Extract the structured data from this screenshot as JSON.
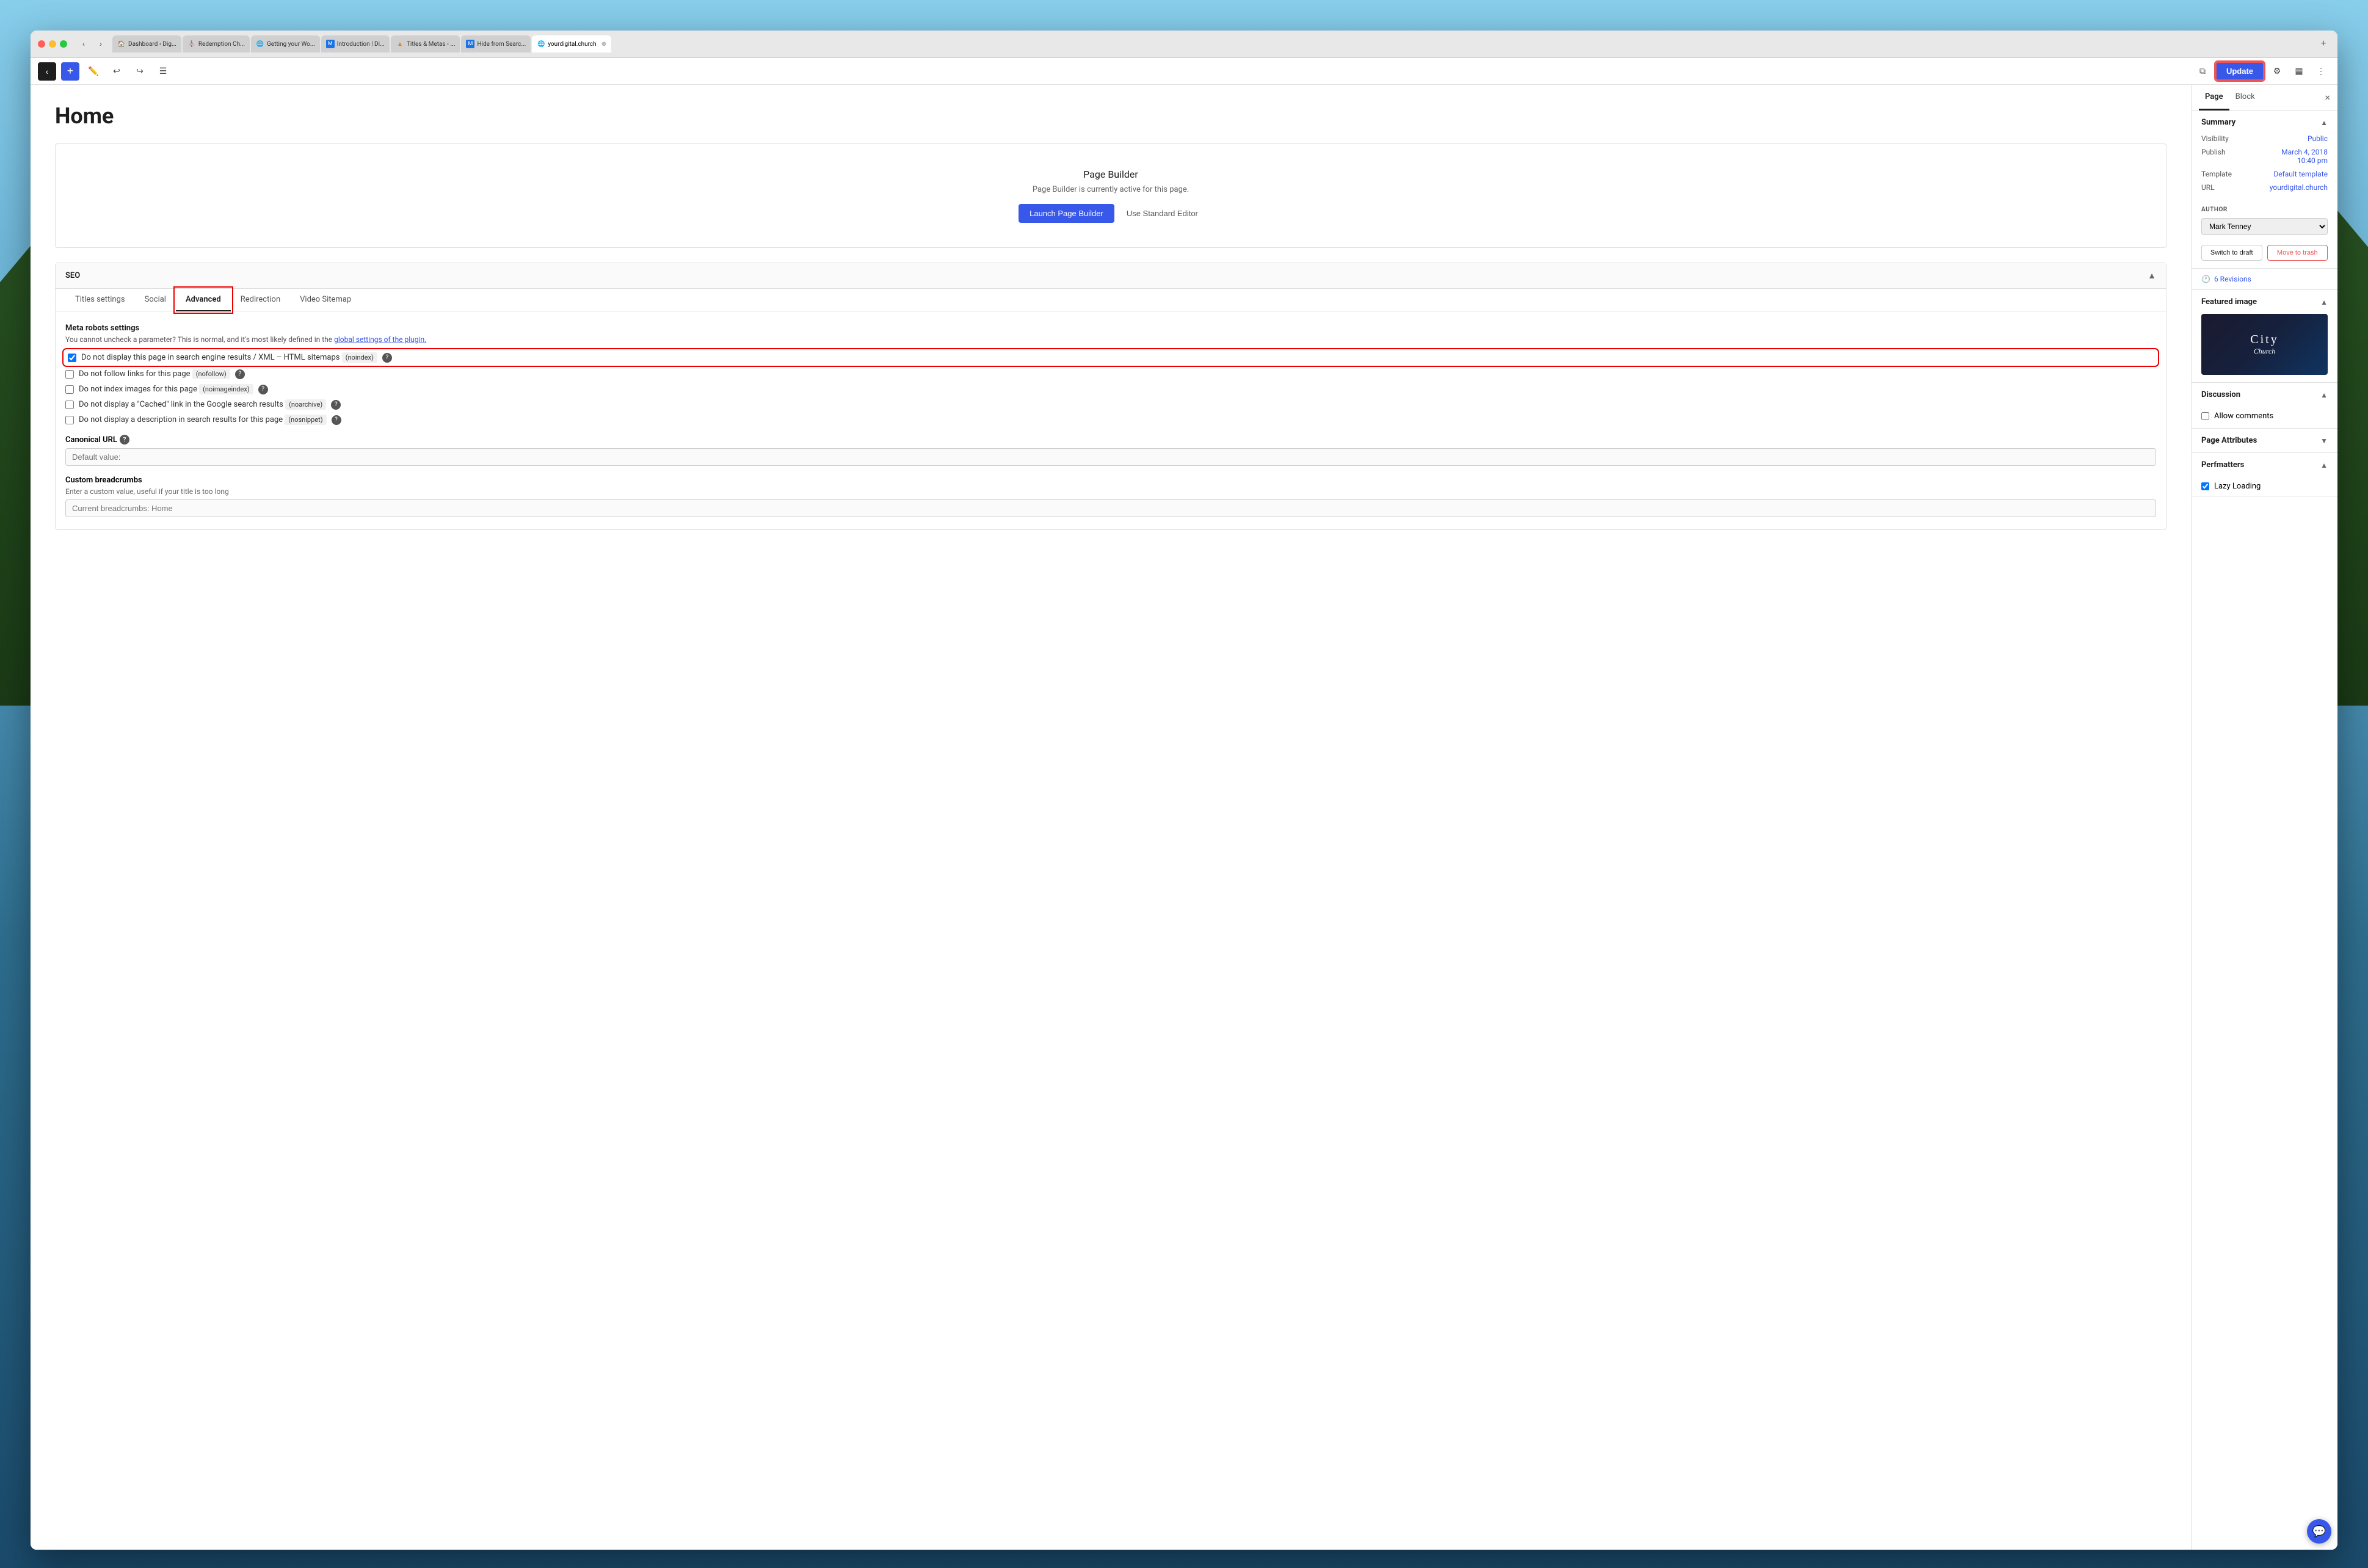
{
  "browser": {
    "tabs": [
      {
        "label": "Dashboard ‹ Dig...",
        "favicon": "🏠",
        "active": false
      },
      {
        "label": "Redemption Ch...",
        "favicon": "⛪",
        "active": false
      },
      {
        "label": "Getting your Wo...",
        "favicon": "🌐",
        "active": false
      },
      {
        "label": "Introduction | Di...",
        "favicon": "M",
        "active": false
      },
      {
        "label": "Titles & Metas ‹ ...",
        "favicon": "▲",
        "active": false
      },
      {
        "label": "Hide from Searc...",
        "favicon": "M",
        "active": false
      },
      {
        "label": "yourdigital.church",
        "favicon": "🌐",
        "active": true
      }
    ],
    "address": "yourdigital.church"
  },
  "toolbar": {
    "add_label": "+",
    "undo_label": "↩",
    "redo_label": "↪",
    "list_label": "☰",
    "update_label": "Update",
    "preview_label": "⧉",
    "settings_label": "⚙",
    "sidebar_label": "▦",
    "more_label": "⋮"
  },
  "page": {
    "title": "Home"
  },
  "page_builder": {
    "title": "Page Builder",
    "description": "Page Builder is currently active for this page.",
    "launch_btn": "Launch Page Builder",
    "standard_btn": "Use Standard Editor"
  },
  "seo": {
    "section_title": "SEO",
    "tabs": [
      "Titles settings",
      "Social",
      "Advanced",
      "Redirection",
      "Video Sitemap"
    ],
    "active_tab": "Advanced",
    "meta_robots": {
      "title": "Meta robots settings",
      "description": "You cannot uncheck a parameter? This is normal, and it's most likely defined in the",
      "link_text": "global settings of the plugin.",
      "checkboxes": [
        {
          "id": "noindex",
          "label": "Do not display this page in search engine results / XML – HTML sitemaps",
          "tag": "noindex",
          "checked": true,
          "highlighted": true
        },
        {
          "id": "nofollow",
          "label": "Do not follow links for this page",
          "tag": "nofollow",
          "checked": false,
          "highlighted": false
        },
        {
          "id": "noimageindex",
          "label": "Do not index images for this page",
          "tag": "noimageindex",
          "checked": false,
          "highlighted": false
        },
        {
          "id": "noarchive",
          "label": "Do not display a \"Cached\" link in the Google search results",
          "tag": "noarchive",
          "checked": false,
          "highlighted": false
        },
        {
          "id": "nosnippet",
          "label": "Do not display a description in search results for this page",
          "tag": "nosnippet",
          "checked": false,
          "highlighted": false
        }
      ]
    },
    "canonical_url": {
      "label": "Canonical URL",
      "placeholder": "Default value:"
    },
    "custom_breadcrumbs": {
      "label": "Custom breadcrumbs",
      "description": "Enter a custom value, useful if your title is too long",
      "placeholder": "Current breadcrumbs: Home"
    }
  },
  "right_sidebar": {
    "tabs": [
      "Page",
      "Block"
    ],
    "active_tab": "Page",
    "close_label": "×",
    "summary": {
      "title": "Summary",
      "rows": [
        {
          "key": "Visibility",
          "value": "Public",
          "link": true
        },
        {
          "key": "Publish",
          "value": "March 4, 2018\n10:40 pm",
          "link": true
        },
        {
          "key": "Template",
          "value": "Default template",
          "link": true
        },
        {
          "key": "URL",
          "value": "yourdigital.church",
          "link": true
        }
      ],
      "author_label": "AUTHOR",
      "author_value": "Mark Tenney",
      "switch_draft": "Switch to draft",
      "move_trash": "Move to trash"
    },
    "revisions": {
      "label": "6 Revisions"
    },
    "featured_image": {
      "title": "Featured image"
    },
    "discussion": {
      "title": "Discussion",
      "allow_comments_label": "Allow comments",
      "allow_comments_checked": false
    },
    "page_attributes": {
      "title": "Page Attributes"
    },
    "perfmatters": {
      "title": "Perfmatters",
      "lazy_loading_label": "Lazy Loading",
      "lazy_loading_checked": true
    }
  },
  "chat": {
    "icon": "💬"
  }
}
